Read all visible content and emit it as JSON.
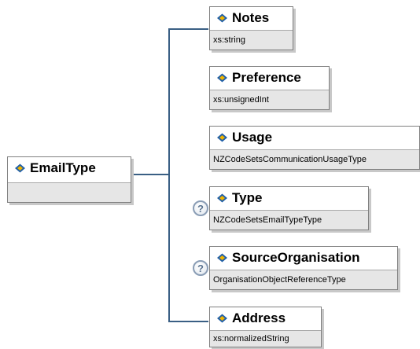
{
  "root": {
    "name": "EmailType",
    "icon": "element-icon",
    "type": ""
  },
  "children": [
    {
      "name": "Notes",
      "type": "xs:string",
      "optional": false,
      "icon": "element-icon"
    },
    {
      "name": "Preference",
      "type": "xs:unsignedInt",
      "optional": false,
      "icon": "element-icon"
    },
    {
      "name": "Usage",
      "type": "NZCodeSetsCommunicationUsageType",
      "optional": false,
      "icon": "element-icon"
    },
    {
      "name": "Type",
      "type": "NZCodeSetsEmailTypeType",
      "optional": true,
      "icon": "element-icon"
    },
    {
      "name": "SourceOrganisation",
      "type": "OrganisationObjectReferenceType",
      "optional": true,
      "icon": "element-icon"
    },
    {
      "name": "Address",
      "type": "xs:normalizedString",
      "optional": false,
      "icon": "element-icon"
    }
  ],
  "optional_marker": "?",
  "colors": {
    "connector": "#3a5f84",
    "footer": "#e6e6e6",
    "border": "#808080",
    "icon_blue": "#1f5fa8",
    "icon_gold": "#f0b400"
  }
}
